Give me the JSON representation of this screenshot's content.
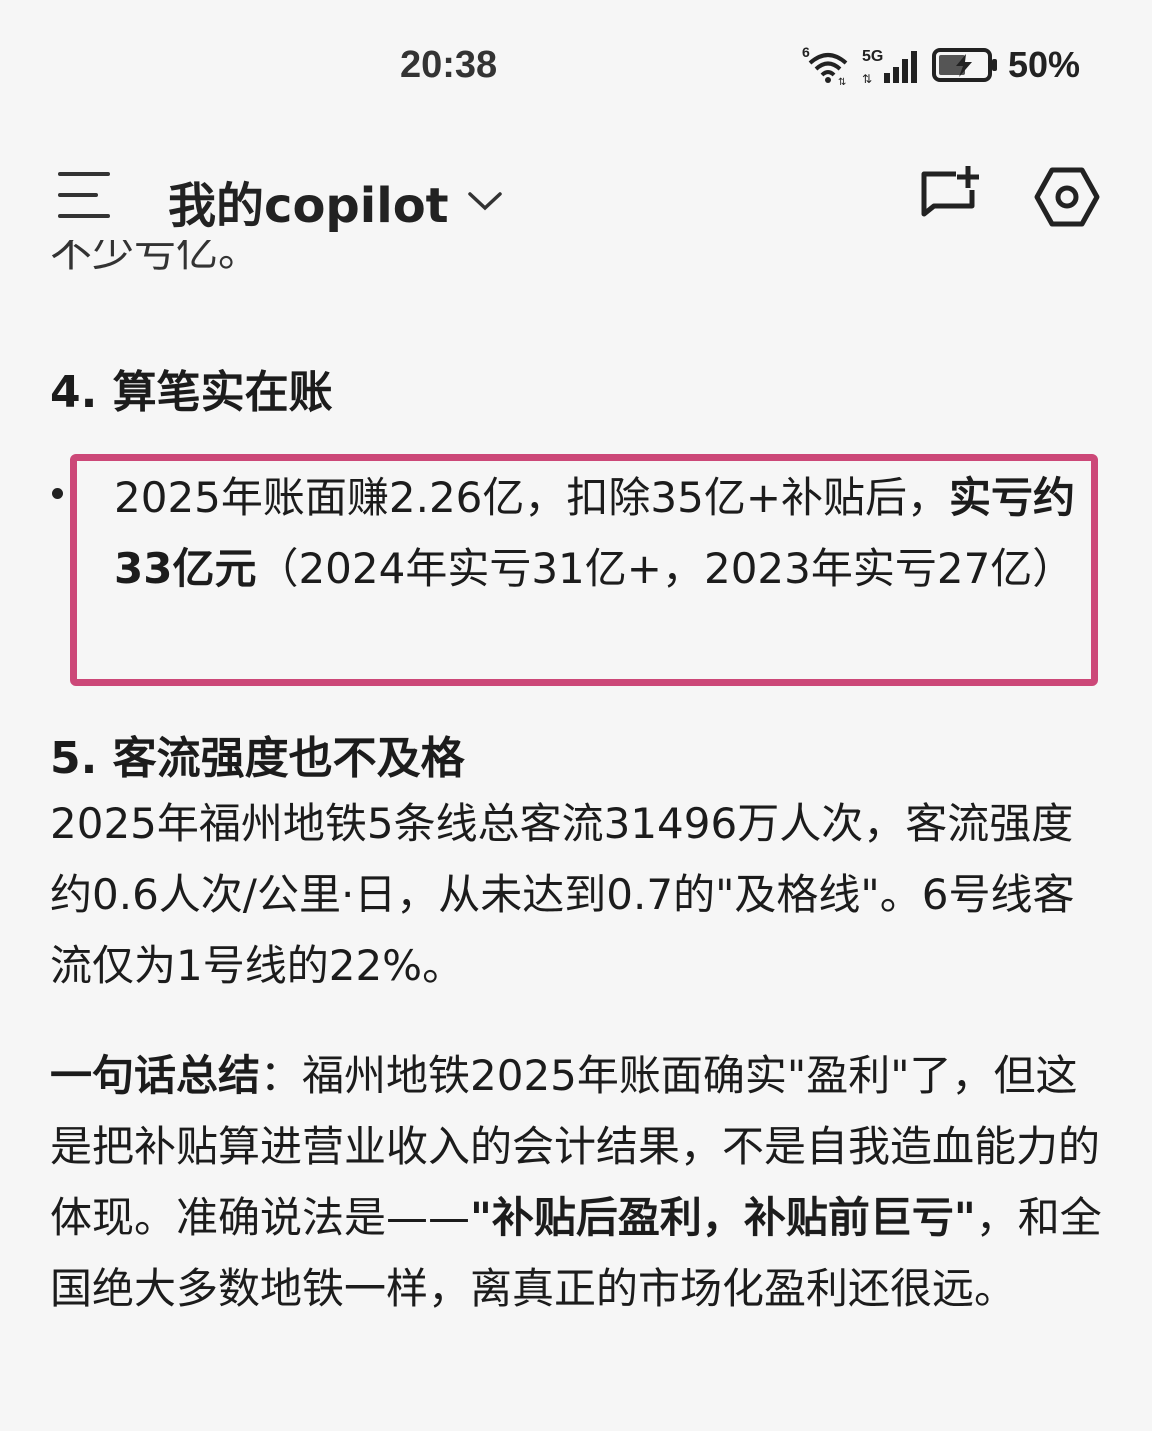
{
  "status_bar": {
    "time": "20:38",
    "battery": "50%",
    "icons": [
      "wifi-6-icon",
      "5g-signal-icon",
      "battery-charging-icon"
    ]
  },
  "header": {
    "title": "我的copilot",
    "icons": [
      "menu-icon",
      "chevron-down-icon",
      "new-chat-icon",
      "settings-icon"
    ]
  },
  "content": {
    "cutoff_line": "不少亏亿。",
    "section4": {
      "heading": "4. 算笔实在账",
      "bullet_part1": "2025年账面赚2.26亿，扣除35亿+补贴后，",
      "bullet_bold": "实亏约33亿元",
      "bullet_part2": "（2024年实亏31亿+，2023年实亏27亿）"
    },
    "section5": {
      "heading": "5. 客流强度也不及格",
      "paragraph": "2025年福州地铁5条线总客流31496万人次，客流强度约0.6人次/公里·日，从未达到0.7的\"及格线\"。6号线客流仅为1号线的22%。"
    },
    "summary": {
      "label": "一句话总结",
      "text1": "：福州地铁2025年账面确实\"盈利\"了，但这是把补贴算进营业收入的会计结果，不是自我造血能力的体现。准确说法是——",
      "bold": "\"补贴后盈利，补贴前巨亏\"",
      "text2": "，和全国绝大多数地铁一样，离真正的市场化盈利还很远。"
    }
  },
  "colors": {
    "background": "#f6f6f6",
    "highlight_border": "#cc4878",
    "text": "#1c1c1c"
  }
}
